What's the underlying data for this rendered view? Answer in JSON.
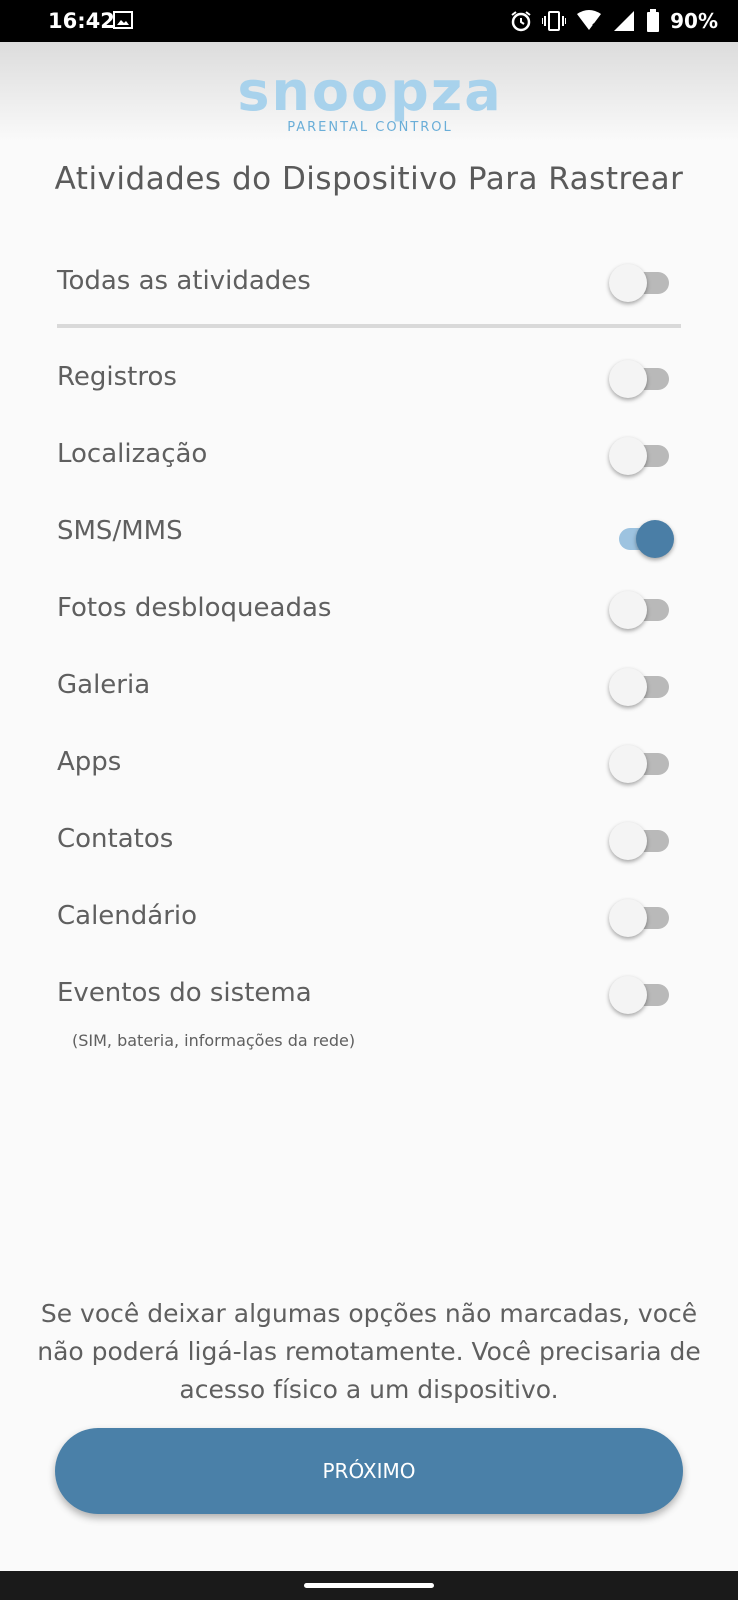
{
  "status_bar": {
    "time": "16:42",
    "battery": "90%",
    "icons": [
      "gallery-icon",
      "alarm-icon",
      "vibrate-icon",
      "wifi-icon",
      "signal-icon",
      "battery-icon"
    ]
  },
  "logo": {
    "word": "snoopza",
    "subtitle": "PARENTAL CONTROL"
  },
  "title": "Atividades do Dispositivo Para Rastrear",
  "all_activities": {
    "label": "Todas as atividades",
    "on": false
  },
  "activities": [
    {
      "label": "Registros",
      "on": false
    },
    {
      "label": "Localização",
      "on": false
    },
    {
      "label": "SMS/MMS",
      "on": true
    },
    {
      "label": "Fotos desbloqueadas",
      "on": false
    },
    {
      "label": "Galeria",
      "on": false
    },
    {
      "label": "Apps",
      "on": false
    },
    {
      "label": "Contatos",
      "on": false
    },
    {
      "label": "Calendário",
      "on": false
    },
    {
      "label": "Eventos do sistema",
      "sublabel": "(SIM, bateria, informações da rede)",
      "on": false
    }
  ],
  "footer_note": "Se você deixar algumas opções não marcadas, você não poderá ligá-las remotamente. Você precisaria de acesso físico a um dispositivo.",
  "next_button": "PRÓXIMO",
  "colors": {
    "accent": "#4a80a8",
    "toggle_on_track": "#9dc3e0",
    "logo": "#a8d2ec"
  }
}
